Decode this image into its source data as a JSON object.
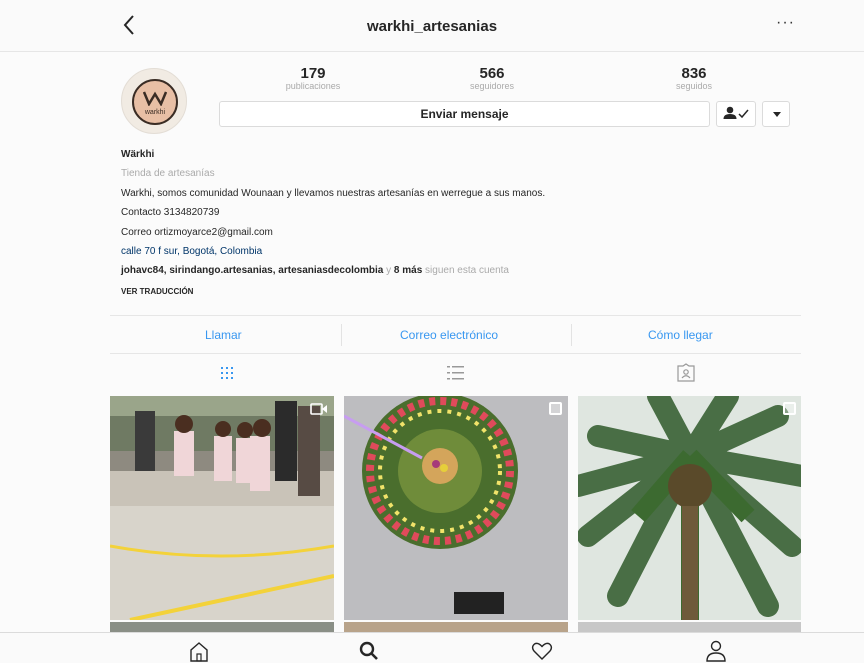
{
  "header": {
    "title": "warkhi_artesanias",
    "more_label": "···"
  },
  "avatar": {
    "brand_text": "warkhi"
  },
  "stats": [
    {
      "value": "179",
      "label": "publicaciones"
    },
    {
      "value": "566",
      "label": "seguidores"
    },
    {
      "value": "836",
      "label": "seguidos"
    }
  ],
  "actions": {
    "message_label": "Enviar mensaje"
  },
  "bio": {
    "name": "Wärkhi",
    "category": "Tienda de artesanías",
    "description": "Warkhi, somos comunidad Wounaan y llevamos nuestras artesanías en werregue a sus manos.",
    "contact": "Contacto 3134820739",
    "email": "Correo ortizmoyarce2@gmail.com",
    "location": "calle 70 f sur, Bogotá, Colombia",
    "followers_names": "johavc84, sirindango.artesanias, artesaniasdecolombia",
    "followers_and": "y",
    "followers_more": "8 más",
    "followers_suffix": "siguen esta cuenta",
    "translate_label": "VER TRADUCCIÓN"
  },
  "contact_bar": {
    "call": "Llamar",
    "email": "Correo electrónico",
    "directions": "Cómo llegar"
  },
  "accent_color": "#3897f0"
}
